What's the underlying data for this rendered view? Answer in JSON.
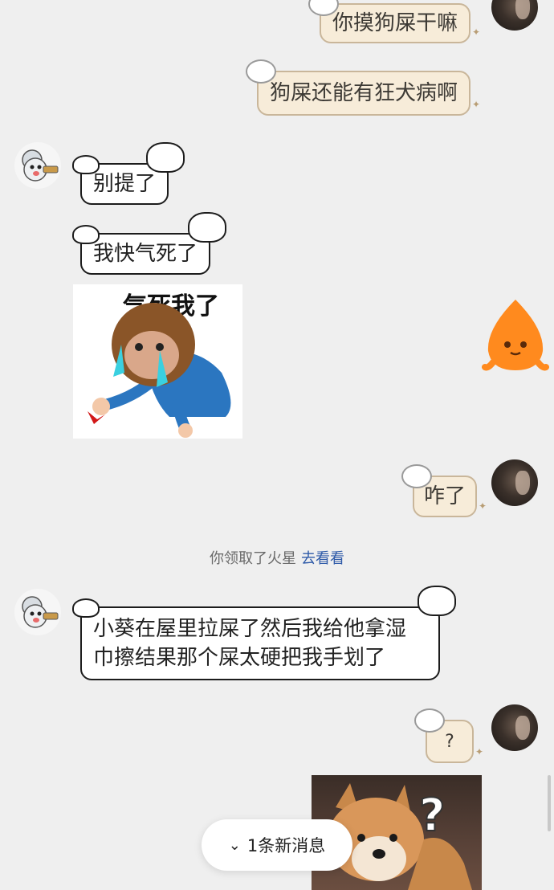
{
  "messages": {
    "m1": "你摸狗屎干嘛",
    "m2": "狗屎还能有狂犬病啊",
    "m3": "别提了",
    "m4": "我快气死了",
    "m5": "咋了",
    "m6_line1": "小葵在屋里拉屎了然后我给他拿湿",
    "m6_line2": "巾擦结果那个屎太硬把我手划了",
    "m7": "?"
  },
  "sticker": {
    "caption": "气死我了"
  },
  "question_mark": "?",
  "system": {
    "text": "你领取了火星",
    "link": "去看看"
  },
  "new_messages": {
    "label": "1条新消息",
    "icon": "chevrons-down-icon"
  },
  "colors": {
    "background": "#efefef",
    "outgoing_bubble": "#f7ecd9",
    "incoming_bubble": "#ffffff",
    "link": "#2e5aa8",
    "mascot": "#ff8a1e"
  }
}
